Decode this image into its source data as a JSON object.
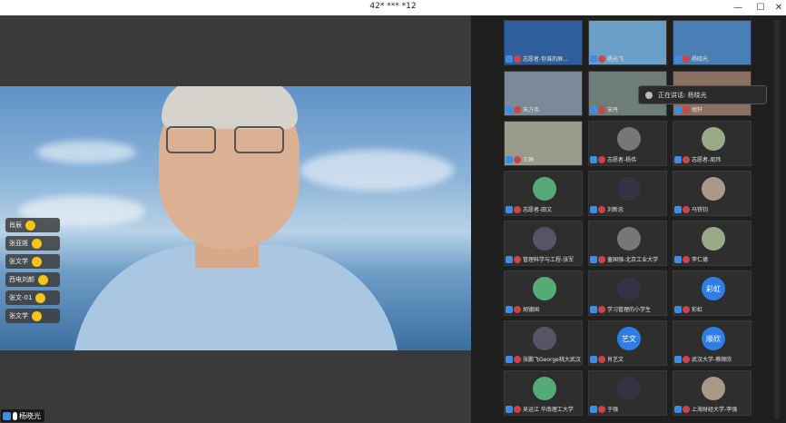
{
  "window": {
    "title": "42* *** *12",
    "minimize": "—",
    "maximize": "☐",
    "close": "✕"
  },
  "main_video": {
    "name": "杨晓光"
  },
  "reactions": [
    "肖辰",
    "张亚姬",
    "张文学",
    "西电刘颜",
    "张文-01",
    "张文学"
  ],
  "speaking_banner": {
    "text": "正在讲话: 杨晓光"
  },
  "tiles": [
    {
      "name": "志愿者-你谁的屏...",
      "kind": "slide"
    },
    {
      "name": "杨光飞",
      "kind": "photo"
    },
    {
      "name": "杨晓光",
      "kind": "photo"
    },
    {
      "name": "朱方伟",
      "kind": "photo"
    },
    {
      "name": "宋丹",
      "kind": "photo"
    },
    {
      "name": "胡轩",
      "kind": "photo"
    },
    {
      "name": "王峥",
      "kind": "photo"
    },
    {
      "name": "志愿者-杨伟",
      "kind": "avatar"
    },
    {
      "name": "志愿者-周玮",
      "kind": "avatar"
    },
    {
      "name": "志愿者-田文",
      "kind": "avatar"
    },
    {
      "name": "刘新忠",
      "kind": "avatar"
    },
    {
      "name": "马铁钧",
      "kind": "avatar"
    },
    {
      "name": "管理科学与工程-张军",
      "kind": "avatar"
    },
    {
      "name": "童国强-北京工业大学",
      "kind": "avatar"
    },
    {
      "name": "李仁德",
      "kind": "avatar"
    },
    {
      "name": "胡德国",
      "kind": "avatar"
    },
    {
      "name": "学习管理的小学生",
      "kind": "avatar"
    },
    {
      "name": "彩虹",
      "kind": "text",
      "badge": "彩虹"
    },
    {
      "name": "张鹏飞George桃大武汉...",
      "kind": "avatar"
    },
    {
      "name": "肖艺文",
      "kind": "text",
      "badge": "艺文"
    },
    {
      "name": "武汉大学-蔡顺欣",
      "kind": "text",
      "badge": "顺欣"
    },
    {
      "name": "吴运江 华南理工大学",
      "kind": "avatar"
    },
    {
      "name": "于强",
      "kind": "avatar"
    },
    {
      "name": "上海财经大学-李强",
      "kind": "avatar"
    }
  ],
  "colors": {
    "accent": "#3a8ee6",
    "reaction": "#f5c518"
  }
}
